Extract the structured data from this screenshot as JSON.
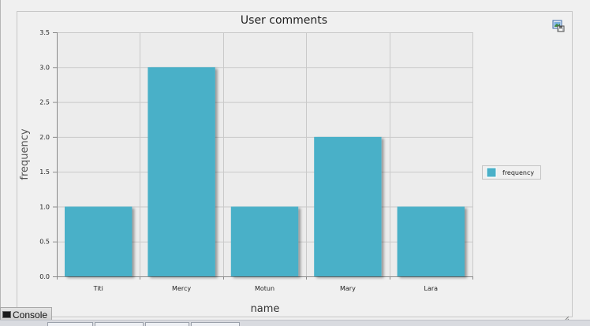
{
  "chart_data": {
    "type": "bar",
    "title": "User comments",
    "xlabel": "name",
    "ylabel": "frequency",
    "categories": [
      "Titi",
      "Mercy",
      "Motun",
      "Mary",
      "Lara"
    ],
    "series": [
      {
        "name": "frequency",
        "values": [
          1.0,
          3.0,
          1.0,
          2.0,
          1.0
        ],
        "color": "#4ab0c8"
      }
    ],
    "ylim": [
      0,
      3.5
    ],
    "yticks": [
      "0.0",
      "0.5",
      "1.0",
      "1.5",
      "2.0",
      "2.5",
      "3.0",
      "3.5"
    ],
    "grid": true,
    "legend_position": "right"
  },
  "toolbar": {
    "export_icon": "export-image-icon"
  },
  "console_tab": {
    "label": "Console",
    "icon": "terminal-icon"
  }
}
